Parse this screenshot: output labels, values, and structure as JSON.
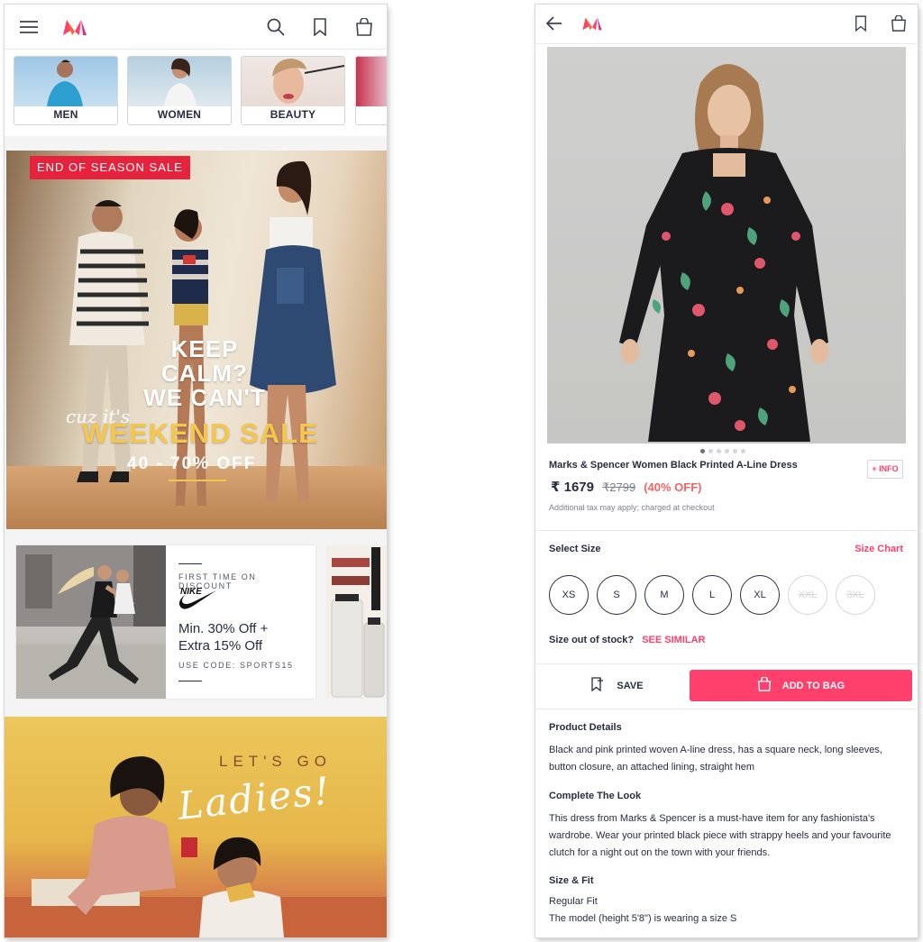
{
  "home": {
    "categories": [
      {
        "label": "MEN"
      },
      {
        "label": "WOMEN"
      },
      {
        "label": "BEAUTY"
      }
    ],
    "hero": {
      "tag": "END OF SEASON SALE",
      "line1": "KEEP",
      "line2": "CALM?",
      "line3": "WE CAN'T",
      "script": "cuz it's",
      "headline": "WEEKEND SALE",
      "discount": "40 - 70% OFF"
    },
    "promo": {
      "kicker": "FIRST TIME ON DISCOUNT",
      "brand": "NIKE",
      "offer_line1": "Min. 30% Off +",
      "offer_line2": "Extra 15% Off",
      "code": "USE CODE: SPORTS15"
    },
    "ladies": {
      "title": "LET'S GO",
      "script": "Ladies!"
    }
  },
  "product": {
    "title": "Marks & Spencer Women Black Printed A-Line Dress",
    "info_label": "+ INFO",
    "currency": "₹",
    "price": "1679",
    "mrp": "2799",
    "discount": "(40% OFF)",
    "tax_note": "Additional tax may apply; charged at checkout",
    "image_dots": 6,
    "active_dot": 0,
    "select_size_label": "Select Size",
    "size_chart_label": "Size Chart",
    "sizes": [
      {
        "label": "XS",
        "available": true
      },
      {
        "label": "S",
        "available": true
      },
      {
        "label": "M",
        "available": true
      },
      {
        "label": "L",
        "available": true
      },
      {
        "label": "XL",
        "available": true
      },
      {
        "label": "XXL",
        "available": false
      },
      {
        "label": "3XL",
        "available": false
      }
    ],
    "oos_question": "Size out of stock?",
    "oos_link": "SEE SIMILAR",
    "save_label": "SAVE",
    "add_to_bag_label": "ADD TO BAG",
    "details_title": "Product Details",
    "details_text": "Black and pink printed woven A-line dress, has a square neck, long sleeves, button closure, an attached lining, straight hem",
    "look_title": "Complete The Look",
    "look_text": "This dress from Marks & Spencer is a must-have item for any fashionista's wardrobe. Wear your printed black piece with strappy heels and your favourite clutch for a night out on the town with your friends.",
    "fit_title": "Size & Fit",
    "fit_line1": "Regular Fit",
    "fit_line2": "The model (height 5'8\") is wearing a size S"
  },
  "colors": {
    "brand_pink": "#ff3f6c",
    "sale_red": "#e6223d",
    "discount_orange": "#f16565",
    "text_dark": "#282c3f"
  }
}
